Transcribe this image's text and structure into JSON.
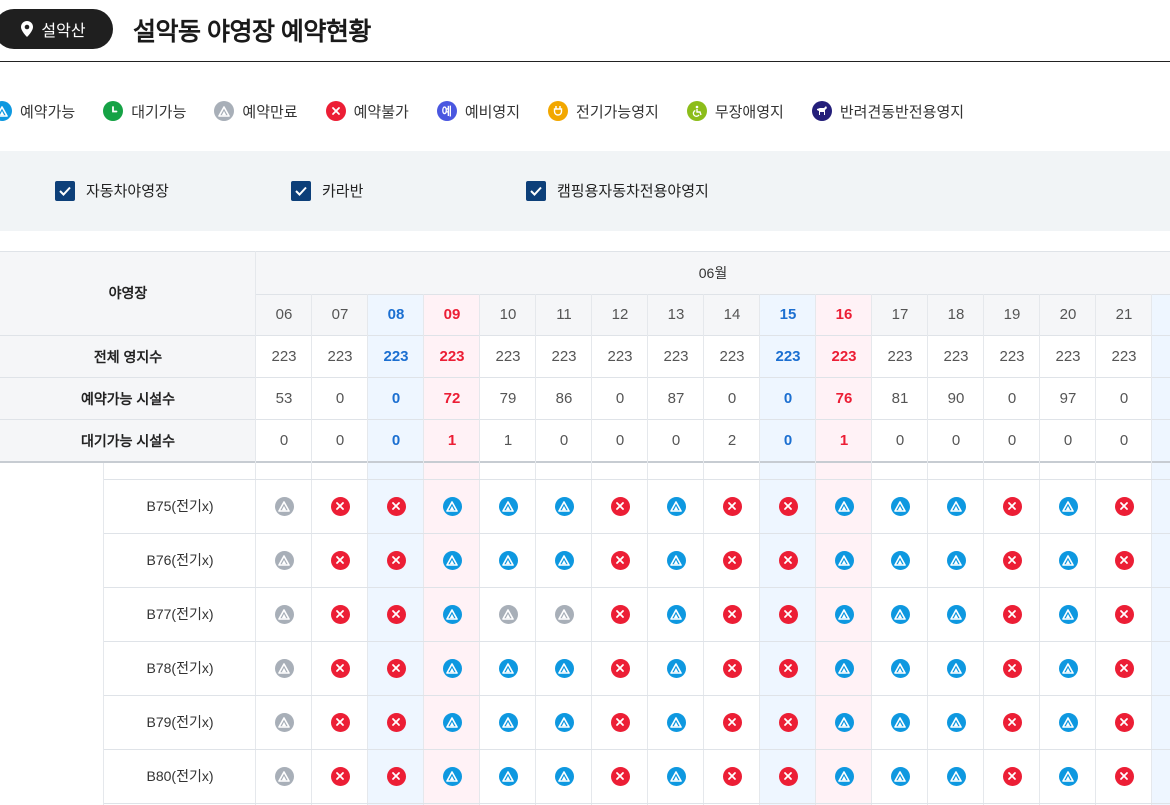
{
  "header": {
    "region": "설악산",
    "title": "설악동 야영장 예약현황"
  },
  "legend": [
    {
      "label": "예약가능",
      "icon": "available-icon"
    },
    {
      "label": "대기가능",
      "icon": "waiting-icon"
    },
    {
      "label": "예약만료",
      "icon": "expired-icon"
    },
    {
      "label": "예약불가",
      "icon": "unavailable-icon"
    },
    {
      "label": "예비영지",
      "icon": "reserve-site-icon",
      "glyph": "예"
    },
    {
      "label": "전기가능영지",
      "icon": "electric-icon"
    },
    {
      "label": "무장애영지",
      "icon": "accessible-icon"
    },
    {
      "label": "반려견동반전용영지",
      "icon": "pet-icon"
    }
  ],
  "filters": [
    {
      "label": "자동차야영장",
      "checked": true
    },
    {
      "label": "카라반",
      "checked": true
    },
    {
      "label": "캠핑용자동차전용야영지",
      "checked": true
    }
  ],
  "table": {
    "corner_label": "야영장",
    "month": "06월",
    "days": [
      "06",
      "07",
      "08",
      "09",
      "10",
      "11",
      "12",
      "13",
      "14",
      "15",
      "16",
      "17",
      "18",
      "19",
      "20",
      "21"
    ],
    "day_types": [
      "",
      "",
      "sat",
      "sun",
      "",
      "",
      "",
      "",
      "",
      "sat",
      "sun",
      "",
      "",
      "",
      "",
      ""
    ],
    "stats": [
      {
        "label": "전체 영지수",
        "values": [
          "223",
          "223",
          "223",
          "223",
          "223",
          "223",
          "223",
          "223",
          "223",
          "223",
          "223",
          "223",
          "223",
          "223",
          "223",
          "223"
        ]
      },
      {
        "label": "예약가능 시설수",
        "values": [
          "53",
          "0",
          "0",
          "72",
          "79",
          "86",
          "0",
          "87",
          "0",
          "0",
          "76",
          "81",
          "90",
          "0",
          "97",
          "0"
        ]
      },
      {
        "label": "대기가능 시설수",
        "values": [
          "0",
          "0",
          "0",
          "1",
          "1",
          "0",
          "0",
          "0",
          "2",
          "0",
          "1",
          "0",
          "0",
          "0",
          "0",
          "0"
        ]
      }
    ],
    "sites": [
      {
        "name": "B75(전기x)",
        "status": [
          "E",
          "X",
          "X",
          "A",
          "A",
          "A",
          "X",
          "A",
          "X",
          "X",
          "A",
          "A",
          "A",
          "X",
          "A",
          "X"
        ]
      },
      {
        "name": "B76(전기x)",
        "status": [
          "E",
          "X",
          "X",
          "A",
          "A",
          "A",
          "X",
          "A",
          "X",
          "X",
          "A",
          "A",
          "A",
          "X",
          "A",
          "X"
        ]
      },
      {
        "name": "B77(전기x)",
        "status": [
          "E",
          "X",
          "X",
          "A",
          "E",
          "E",
          "X",
          "A",
          "X",
          "X",
          "A",
          "A",
          "A",
          "X",
          "A",
          "X"
        ]
      },
      {
        "name": "B78(전기x)",
        "status": [
          "E",
          "X",
          "X",
          "A",
          "A",
          "A",
          "X",
          "A",
          "X",
          "X",
          "A",
          "A",
          "A",
          "X",
          "A",
          "X"
        ]
      },
      {
        "name": "B79(전기x)",
        "status": [
          "E",
          "X",
          "X",
          "A",
          "A",
          "A",
          "X",
          "A",
          "X",
          "X",
          "A",
          "A",
          "A",
          "X",
          "A",
          "X"
        ]
      },
      {
        "name": "B80(전기x)",
        "status": [
          "E",
          "X",
          "X",
          "A",
          "A",
          "A",
          "X",
          "A",
          "X",
          "X",
          "A",
          "A",
          "A",
          "X",
          "A",
          "X"
        ]
      }
    ]
  }
}
